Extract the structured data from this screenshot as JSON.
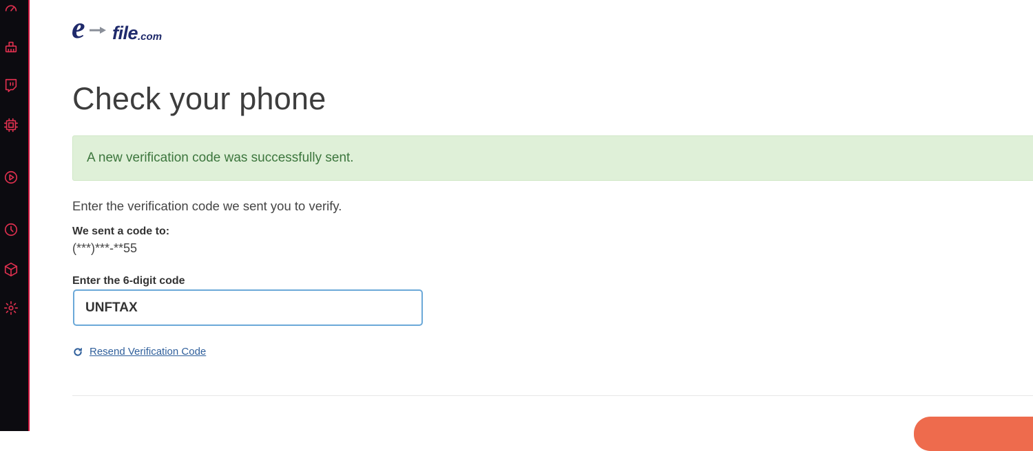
{
  "sidebar": {
    "icons": [
      "speedometer-icon",
      "broom-icon",
      "twitch-icon",
      "chip-icon",
      "play-circle-icon",
      "clock-icon",
      "cube-icon",
      "gear-icon"
    ]
  },
  "logo": {
    "letter": "e",
    "word": "file",
    "tld": ".com"
  },
  "page": {
    "title": "Check your phone"
  },
  "alert": {
    "message": "A new verification code was successfully sent.",
    "color": "#3c763d",
    "background": "#dff0d8"
  },
  "form": {
    "instruction": "Enter the verification code we sent you to verify.",
    "sent_label": "We sent a code to:",
    "sent_value": "(***)***-**55",
    "code_label": "Enter the 6-digit code",
    "code_value": "UNFTAX",
    "resend_label": "Resend Verification Code"
  },
  "colors": {
    "accent_button": "#ee6b4d",
    "link": "#2f5f9b",
    "sidebar_icon": "#e0304f"
  }
}
